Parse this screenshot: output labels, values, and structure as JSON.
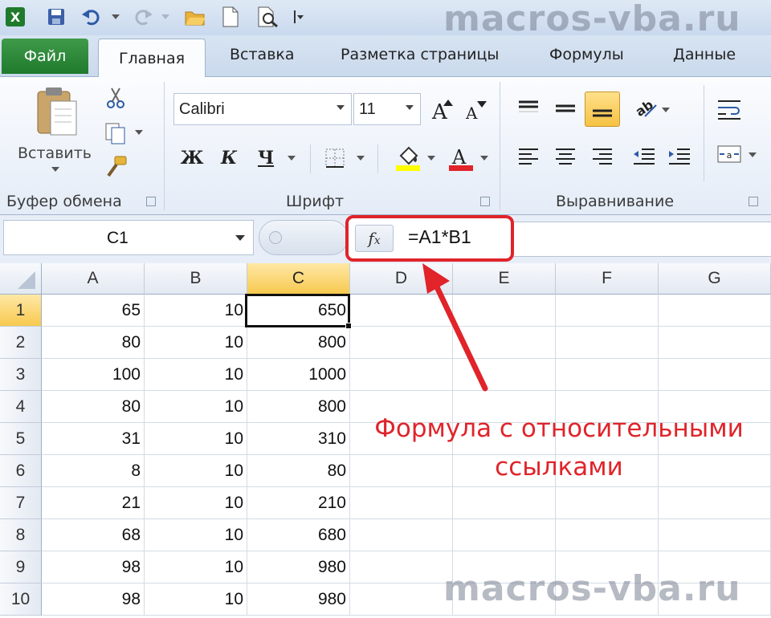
{
  "watermark": "macros-vba.ru",
  "tabs": {
    "file": "Файл",
    "items": [
      "Главная",
      "Вставка",
      "Разметка страницы",
      "Формулы",
      "Данные"
    ]
  },
  "ribbon": {
    "clipboard": {
      "paste_label": "Вставить",
      "group_label": "Буфер обмена"
    },
    "font": {
      "font_name": "Calibri",
      "font_size": "11",
      "bold": "Ж",
      "italic": "К",
      "underline": "Ч",
      "group_label": "Шрифт"
    },
    "alignment": {
      "group_label": "Выравнивание"
    }
  },
  "formula_bar": {
    "name_box": "C1",
    "fx_label": "fx",
    "formula": "=A1*B1"
  },
  "grid": {
    "columns": [
      "A",
      "B",
      "C",
      "D",
      "E",
      "F",
      "G"
    ],
    "selected_column": "C",
    "selected_row": "1",
    "rows": [
      {
        "num": "1",
        "a": "65",
        "b": "10",
        "c": "650"
      },
      {
        "num": "2",
        "a": "80",
        "b": "10",
        "c": "800"
      },
      {
        "num": "3",
        "a": "100",
        "b": "10",
        "c": "1000"
      },
      {
        "num": "4",
        "a": "80",
        "b": "10",
        "c": "800"
      },
      {
        "num": "5",
        "a": "31",
        "b": "10",
        "c": "310"
      },
      {
        "num": "6",
        "a": "8",
        "b": "10",
        "c": "80"
      },
      {
        "num": "7",
        "a": "21",
        "b": "10",
        "c": "210"
      },
      {
        "num": "8",
        "a": "68",
        "b": "10",
        "c": "680"
      },
      {
        "num": "9",
        "a": "98",
        "b": "10",
        "c": "980"
      },
      {
        "num": "10",
        "a": "98",
        "b": "10",
        "c": "980"
      }
    ]
  },
  "annotation": {
    "line1": "Формула с относительными",
    "line2": "ссылками",
    "color": "#e0242a"
  }
}
